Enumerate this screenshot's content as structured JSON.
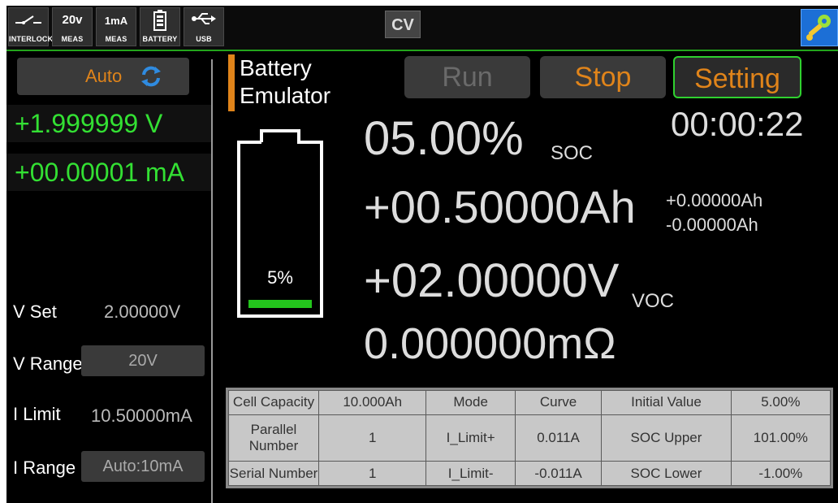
{
  "statusbar": {
    "interlock_label": "INTERLOCK",
    "meas_v_value": "20v",
    "meas_v_label": "MEAS",
    "meas_i_value": "1mA",
    "meas_i_label": "MEAS",
    "battery_label": "BATTERY",
    "usb_label": "USB",
    "mode_badge": "CV"
  },
  "left": {
    "auto_label": "Auto",
    "voltage": "+1.999999 V",
    "current": "+00.00001 mA",
    "v_set_label": "V Set",
    "v_set_value": "2.00000V",
    "v_range_label": "V Range",
    "v_range_value": "20V",
    "i_limit_label": "I Limit",
    "i_limit_value": "10.50000mA",
    "i_range_label": "I Range",
    "i_range_value": "Auto:10mA"
  },
  "main": {
    "title_line1": "Battery",
    "title_line2": "Emulator",
    "run_label": "Run",
    "stop_label": "Stop",
    "setting_label": "Setting",
    "timer": "00:00:22",
    "battery_percent": "5%",
    "battery_level": 0.05,
    "soc_value": "05.00%",
    "soc_label": "SOC",
    "ah_value": "+00.50000Ah",
    "ah_plus": "+0.00000Ah",
    "ah_minus": "-0.00000Ah",
    "voc_value": "+02.00000V",
    "voc_label": "VOC",
    "resistance_value": "0.000000mΩ"
  },
  "table": {
    "rows": [
      [
        "Cell Capacity",
        "10.000Ah",
        "Mode",
        "Curve",
        "Initial Value",
        "5.00%"
      ],
      [
        "Parallel Number",
        "1",
        "I_Limit+",
        "0.011A",
        "SOC Upper",
        "101.00%"
      ],
      [
        "Serial Number",
        "1",
        "I_Limit-",
        "-0.011A",
        "SOC Lower",
        "-1.00%"
      ]
    ]
  },
  "colors": {
    "accent_orange": "#e0841a",
    "measure_green": "#33e033",
    "bar_green": "#23a51c"
  }
}
